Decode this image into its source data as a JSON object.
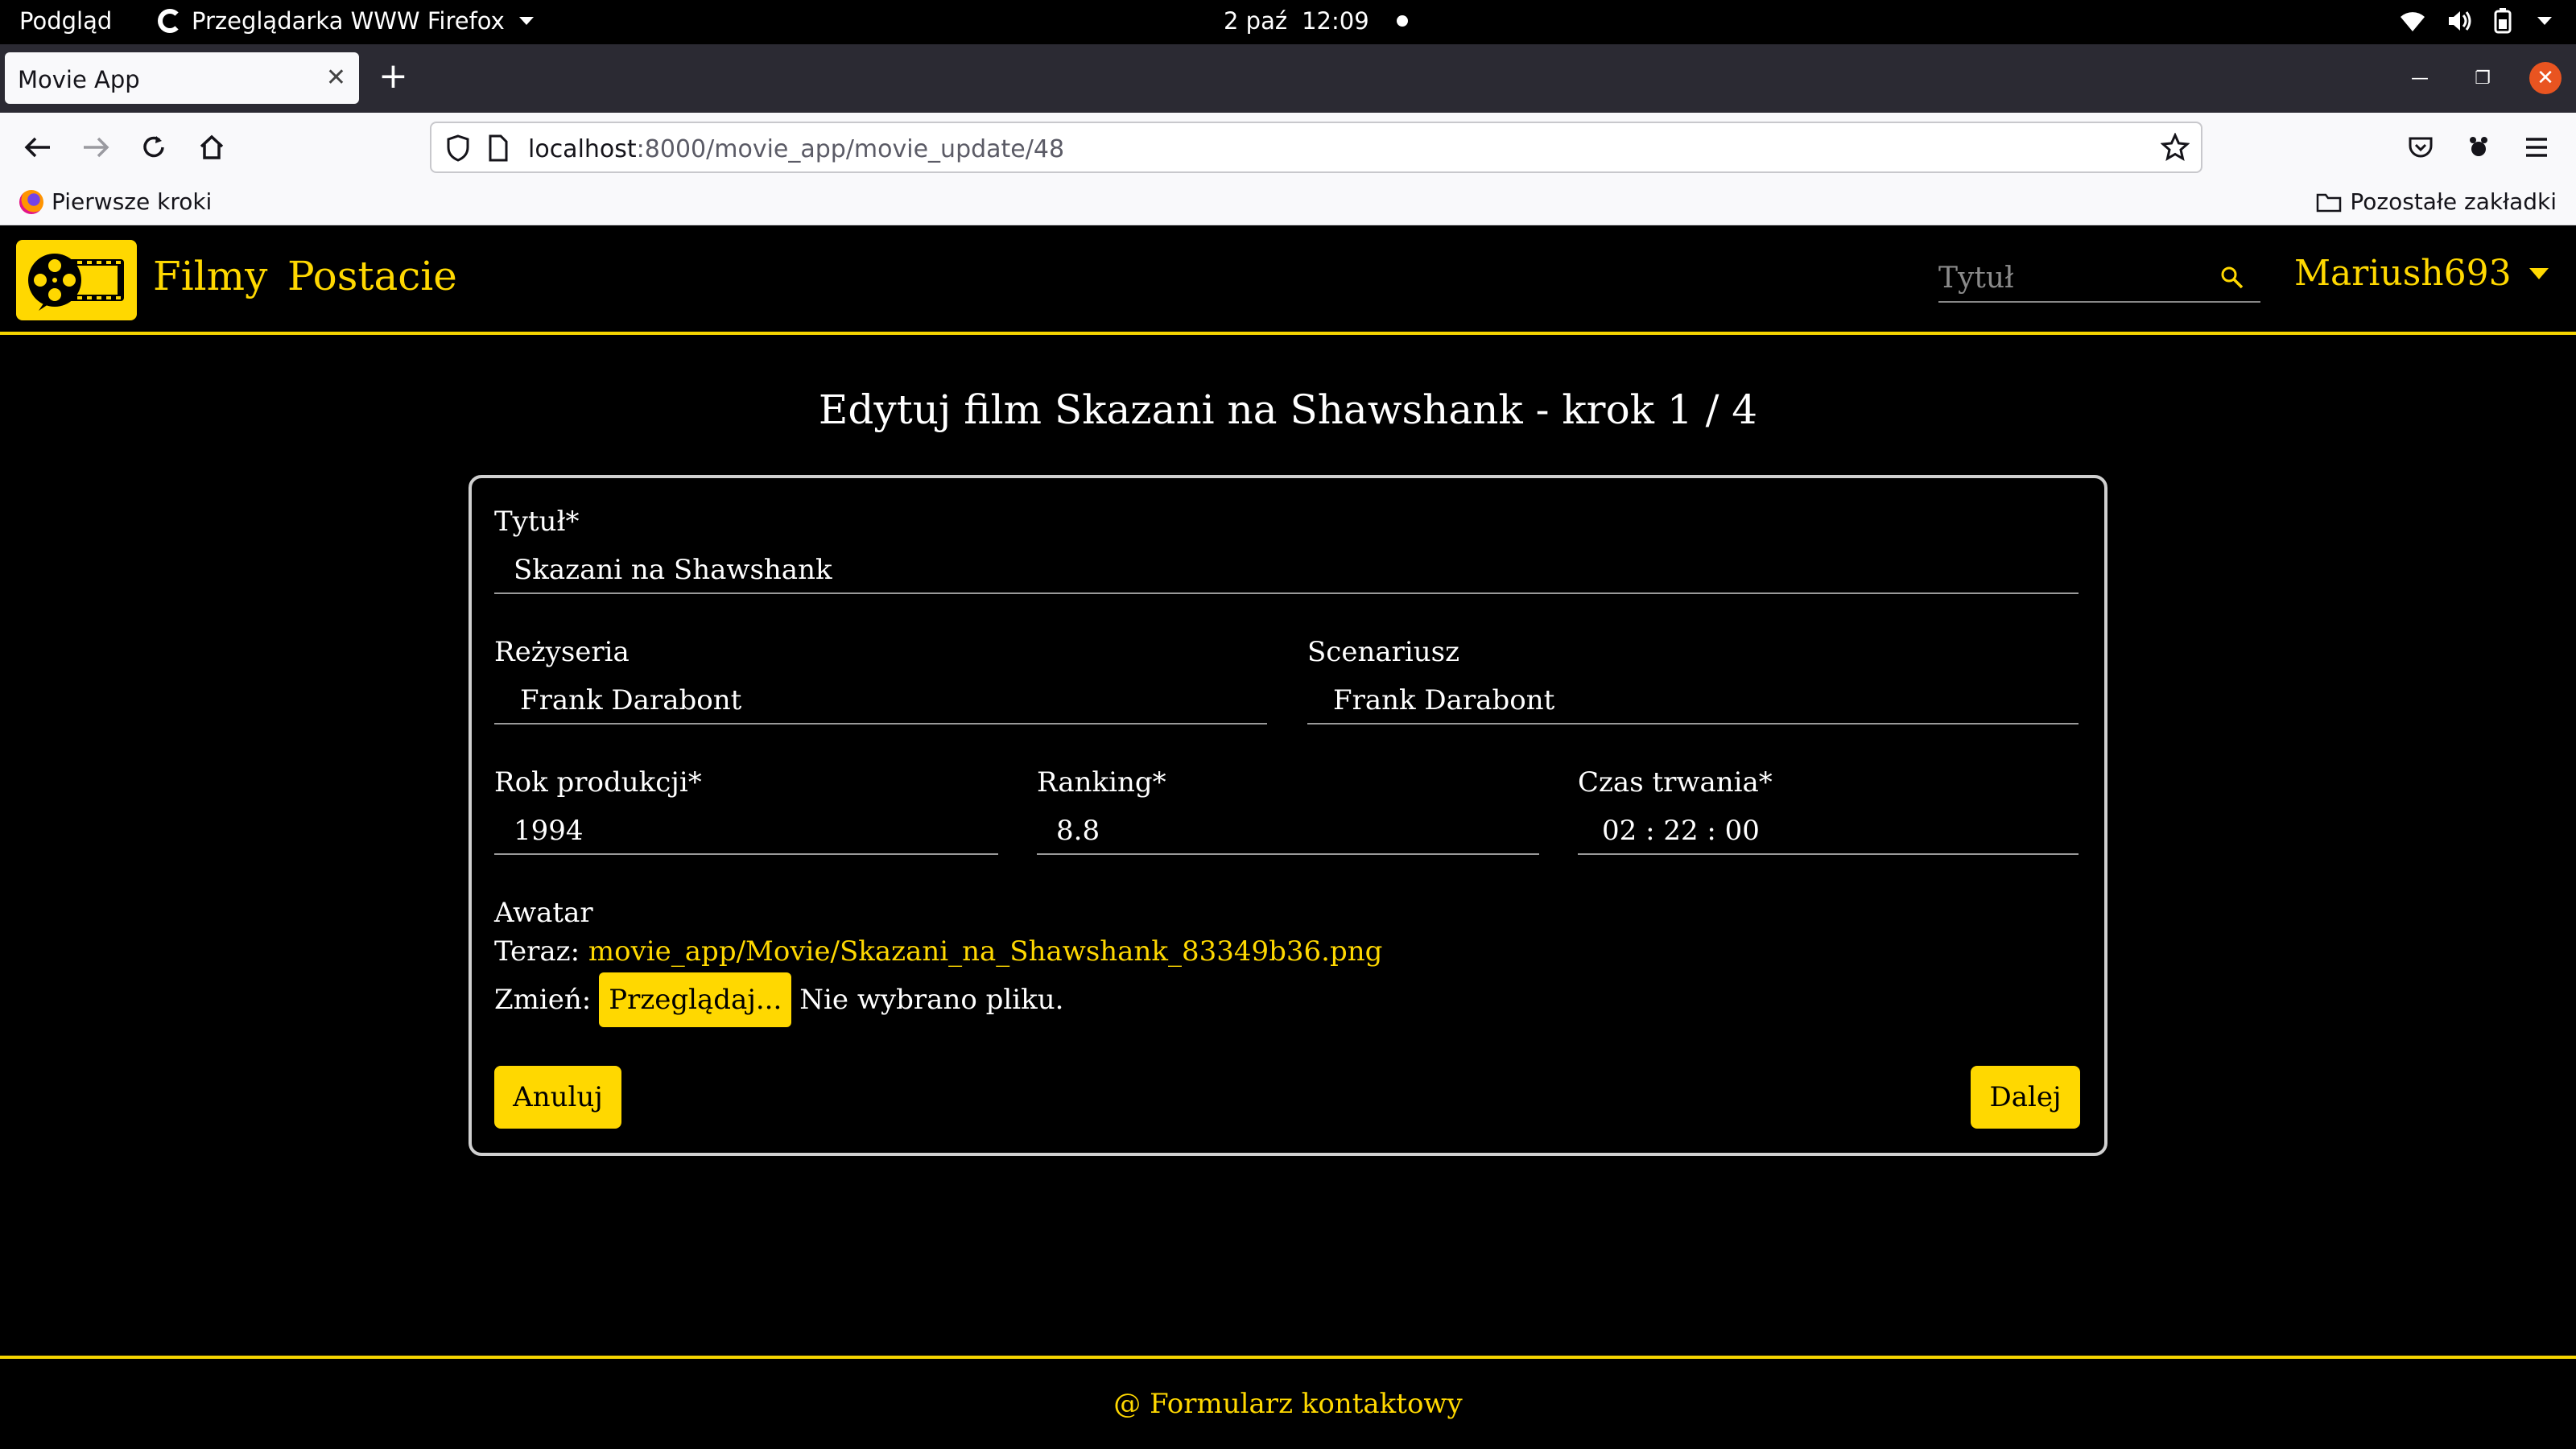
{
  "system_bar": {
    "activities": "Podgląd",
    "app_name": "Przeglądarka WWW Firefox",
    "date": "2 paź",
    "time": "12:09"
  },
  "browser": {
    "tab_title": "Movie App",
    "url_host": "localhost",
    "url_path": ":8000/movie_app/movie_update/48",
    "bookmark_left": "Pierwsze kroki",
    "bookmark_right": "Pozostałe zakładki"
  },
  "site": {
    "nav": {
      "films": "Filmy",
      "characters": "Postacie",
      "search_placeholder": "Tytuł",
      "username": "Mariush693"
    },
    "page_title": "Edytuj film Skazani na Shawshank - krok 1 / 4",
    "form": {
      "title_label": "Tytuł*",
      "title_value": "Skazani na Shawshank",
      "director_label": "Reżyseria",
      "director_value": "Frank Darabont",
      "screenplay_label": "Scenariusz",
      "screenplay_value": "Frank Darabont",
      "year_label": "Rok produkcji*",
      "year_value": "1994",
      "ranking_label": "Ranking*",
      "ranking_value": "8.8",
      "duration_label": "Czas trwania*",
      "duration_value": "02 : 22 : 00",
      "avatar_label": "Awatar",
      "current_prefix": "Teraz:",
      "current_file": "movie_app/Movie/Skazani_na_Shawshank_83349b36.png",
      "change_prefix": "Zmień:",
      "browse_label": "Przeglądaj...",
      "no_file": "Nie wybrano pliku.",
      "cancel_label": "Anuluj",
      "next_label": "Dalej"
    },
    "footer_link": "@ Formularz kontaktowy"
  },
  "colors": {
    "accent": "#ffd800",
    "background": "#000000",
    "browser_chrome": "#2b2a33",
    "ubuntu_close": "#e95420"
  }
}
